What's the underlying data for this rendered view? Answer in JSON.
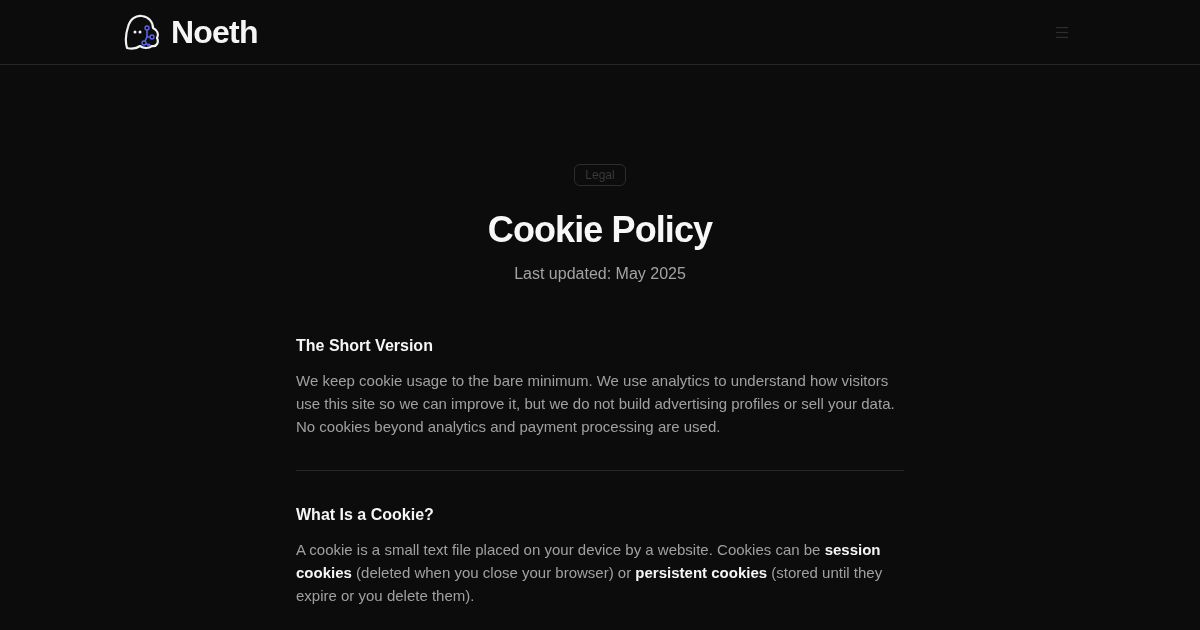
{
  "header": {
    "logo_text": "Noeth"
  },
  "hero": {
    "badge": "Legal",
    "title": "Cookie Policy",
    "subtitle": "Last updated: May 2025"
  },
  "sections": [
    {
      "heading": "The Short Version",
      "body": "We keep cookie usage to the bare minimum. We use analytics to understand how visitors use this site so we can improve it, but we do not build advertising profiles or sell your data. No cookies beyond analytics and payment processing are used."
    },
    {
      "heading": "What Is a Cookie?",
      "body": "A cookie is a small text file placed on your device by a website. Cookies can be **session cookies** (deleted when you close your browser) or **persistent cookies** (stored until they expire or you delete them)."
    }
  ]
}
